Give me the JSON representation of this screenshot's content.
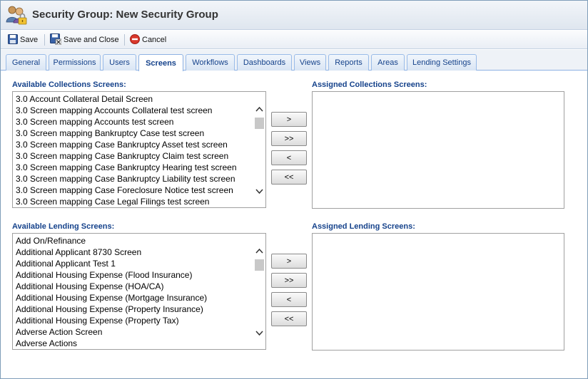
{
  "window": {
    "title": "Security Group: New Security Group"
  },
  "toolbar": {
    "save_label": "Save",
    "save_close_label": "Save and Close",
    "cancel_label": "Cancel"
  },
  "tabs": [
    {
      "label": "General"
    },
    {
      "label": "Permissions"
    },
    {
      "label": "Users"
    },
    {
      "label": "Screens"
    },
    {
      "label": "Workflows"
    },
    {
      "label": "Dashboards"
    },
    {
      "label": "Views"
    },
    {
      "label": "Reports"
    },
    {
      "label": "Areas"
    },
    {
      "label": "Lending Settings"
    }
  ],
  "active_tab": "Screens",
  "collections": {
    "available_label": "Available Collections Screens:",
    "assigned_label": "Assigned Collections Screens:",
    "available_items": [
      "3.0 Account Collateral Detail Screen",
      "3.0 Screen mapping Accounts Collateral test screen",
      "3.0 Screen mapping Accounts test screen",
      "3.0 Screen mapping Bankruptcy Case test screen",
      "3.0 Screen mapping Case Bankruptcy Asset test screen",
      "3.0 Screen mapping Case Bankruptcy Claim test screen",
      "3.0 Screen mapping Case Bankruptcy Hearing test screen",
      "3.0 Screen mapping Case Bankruptcy Liability test screen",
      "3.0 Screen mapping Case Foreclosure Notice test screen",
      "3.0 Screen mapping Case Legal Filings test screen"
    ],
    "assigned_items": []
  },
  "lending": {
    "available_label": "Available Lending Screens:",
    "assigned_label": "Assigned Lending Screens:",
    "available_items": [
      "Add On/Refinance",
      "Additional Applicant 8730 Screen",
      "Additional Applicant Test 1",
      "Additional Housing Expense (Flood Insurance)",
      "Additional Housing Expense (HOA/CA)",
      "Additional Housing Expense (Mortgage Insurance)",
      "Additional Housing Expense (Property Insurance)",
      "Additional Housing Expense (Property Tax)",
      "Adverse Action Screen",
      "Adverse Actions"
    ],
    "assigned_items": []
  },
  "move_buttons": {
    "add": ">",
    "add_all": ">>",
    "remove": "<",
    "remove_all": "<<"
  },
  "icons": {
    "title": "security-group-users-icon",
    "save": "floppy-disk-icon",
    "save_close": "floppy-disk-close-icon",
    "cancel": "cancel-circle-icon"
  },
  "colors": {
    "accent": "#15428b",
    "tab_border": "#99bbe8",
    "cancel_red": "#d9372b"
  }
}
